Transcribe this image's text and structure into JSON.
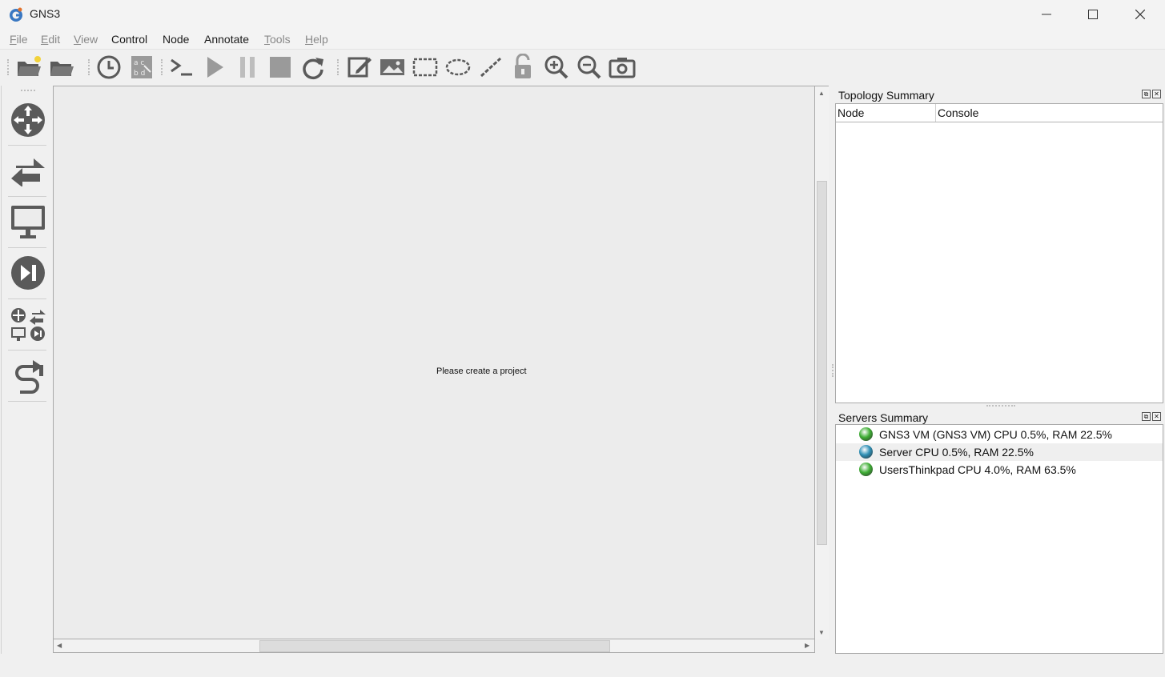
{
  "window": {
    "title": "GNS3"
  },
  "menu": [
    {
      "label": "File",
      "mnemonic": "F",
      "rest": "ile",
      "enabled": false
    },
    {
      "label": "Edit",
      "mnemonic": "E",
      "rest": "dit",
      "enabled": false
    },
    {
      "label": "View",
      "mnemonic": "V",
      "rest": "iew",
      "enabled": false
    },
    {
      "label": "Control",
      "enabled": true
    },
    {
      "label": "Node",
      "enabled": true
    },
    {
      "label": "Annotate",
      "enabled": true
    },
    {
      "label": "Tools",
      "mnemonic": "T",
      "rest": "ools",
      "enabled": false
    },
    {
      "label": "Help",
      "mnemonic": "H",
      "rest": "elp",
      "enabled": false
    }
  ],
  "toolbar": {
    "icons": [
      "new-project-icon",
      "open-project-icon",
      "snapshot-icon",
      "show-labels-icon",
      "console-all-icon",
      "start-all-icon",
      "suspend-all-icon",
      "stop-all-icon",
      "reload-all-icon",
      "add-note-icon",
      "insert-picture-icon",
      "draw-rectangle-icon",
      "draw-ellipse-icon",
      "draw-line-icon",
      "lock-unlock-icon",
      "zoom-in-icon",
      "zoom-out-icon",
      "screenshot-icon"
    ]
  },
  "device_dock": {
    "icons": [
      "routers-icon",
      "switches-icon",
      "end-devices-icon",
      "security-devices-icon",
      "all-devices-icon",
      "add-link-icon"
    ]
  },
  "canvas": {
    "message": "Please create a project"
  },
  "topology_summary": {
    "title": "Topology Summary",
    "columns": [
      "Node",
      "Console"
    ]
  },
  "servers_summary": {
    "title": "Servers Summary",
    "servers": [
      {
        "label": "GNS3 VM (GNS3 VM) CPU 0.5%, RAM 22.5%",
        "status_color": "#3fae35",
        "selected": false
      },
      {
        "label": "Server CPU 0.5%, RAM 22.5%",
        "status_color": "#2e8fb5",
        "selected": true
      },
      {
        "label": "UsersThinkpad CPU 4.0%, RAM 63.5%",
        "status_color": "#3fae35",
        "selected": false
      }
    ]
  },
  "colors": {
    "icon_gray": "#5a5a5a",
    "window_bg": "#f0f0f0",
    "accent": "#2e8fb5"
  }
}
